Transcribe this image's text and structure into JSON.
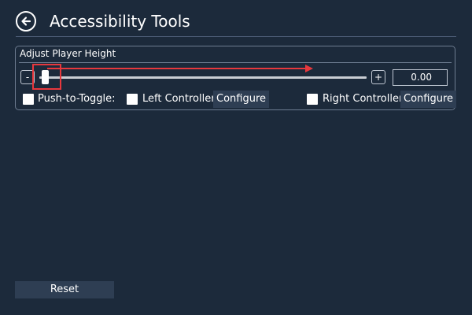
{
  "header": {
    "back_icon": "back-arrow-icon",
    "title": "Accessibility Tools"
  },
  "player_height": {
    "group_title": "Adjust Player Height",
    "decrement_label": "-",
    "increment_label": "+",
    "slider_value_fraction": 0.0,
    "value": "0.00",
    "annotation_color": "#e8383d"
  },
  "options": {
    "push_to_toggle": {
      "label": "Push-to-Toggle:",
      "checked": false
    },
    "left_controller": {
      "label": "Left Controller",
      "checked": false,
      "configure_label": "Configure"
    },
    "right_controller": {
      "label": "Right Controller",
      "checked": false,
      "configure_label": "Configure"
    }
  },
  "footer": {
    "reset_label": "Reset"
  },
  "colors": {
    "background": "#1c2a3b",
    "button": "#2e3e53",
    "border": "#6d7c90"
  }
}
